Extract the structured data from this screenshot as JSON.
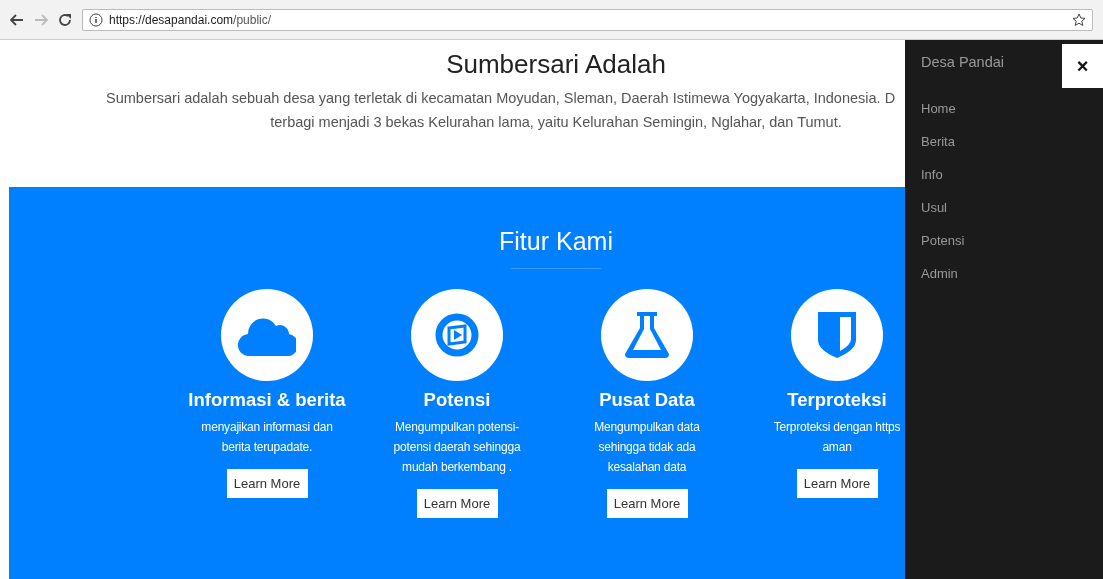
{
  "browser": {
    "url_host": "https://desapandai.com",
    "url_path": "/public/"
  },
  "intro": {
    "title": "Sumbersari Adalah",
    "line_1": "Sumbersari adalah sebuah desa yang terletak di kecamatan Moyudan, Sleman, Daerah Istimewa Yogyakarta, Indonesia. D",
    "line_2": "terbagi menjadi 3 bekas Kelurahan lama, yaitu Kelurahan Semingin, Nglahar, dan Tumut."
  },
  "features": {
    "title": "Fitur Kami",
    "items": [
      {
        "title": "Informasi & berita",
        "text": "menyajikan informasi dan berita terupadate.",
        "button": "Learn More"
      },
      {
        "title": "Potensi",
        "text": "Mengumpulkan potensi-potensi daerah sehingga mudah berkembang .",
        "button": "Learn More"
      },
      {
        "title": "Pusat Data",
        "text": "Mengumpulkan data sehingga tidak ada kesalahan data",
        "button": "Learn More"
      },
      {
        "title": "Terproteksi",
        "text": "Terproteksi dengan https aman",
        "button": "Learn More"
      }
    ]
  },
  "sidebar": {
    "brand": "Desa Pandai",
    "close": "×",
    "items": [
      "Home",
      "Berita",
      "Info",
      "Usul",
      "Potensi",
      "Admin"
    ]
  }
}
